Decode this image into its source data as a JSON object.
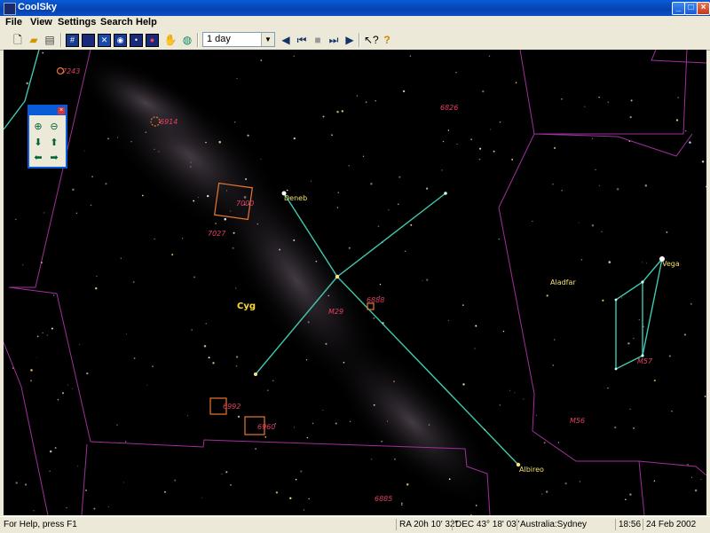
{
  "window": {
    "title": "CoolSky"
  },
  "menu": [
    "File",
    "View",
    "Settings",
    "Search",
    "Help"
  ],
  "toolbar": {
    "time_step": "1 day"
  },
  "sky": {
    "stars": [
      {
        "name": "Deneb",
        "label": "Deneb"
      },
      {
        "name": "Vega",
        "label": "Vega"
      },
      {
        "name": "Albireo",
        "label": "Albireo"
      },
      {
        "name": "Aladfar",
        "label": "Aladfar"
      }
    ],
    "constellation": "Cyg",
    "objects": [
      "7243",
      "7000",
      "7027",
      "6888",
      "M29",
      "6992",
      "6960",
      "6826",
      "M57",
      "M56",
      "6885",
      "6914"
    ]
  },
  "status": {
    "help": "For Help, press F1",
    "ra": "RA 20h 10' 32\"",
    "dec": "DEC 43° 18' 03\"",
    "location": "Australia:Sydney",
    "time": "18:56",
    "date": "24 Feb 2002"
  },
  "colors": {
    "sky": "#000000",
    "boundary": "#a0309a",
    "lines": "#40c8b0",
    "nebula_label": "#e04060",
    "star_label": "#f0e070"
  }
}
